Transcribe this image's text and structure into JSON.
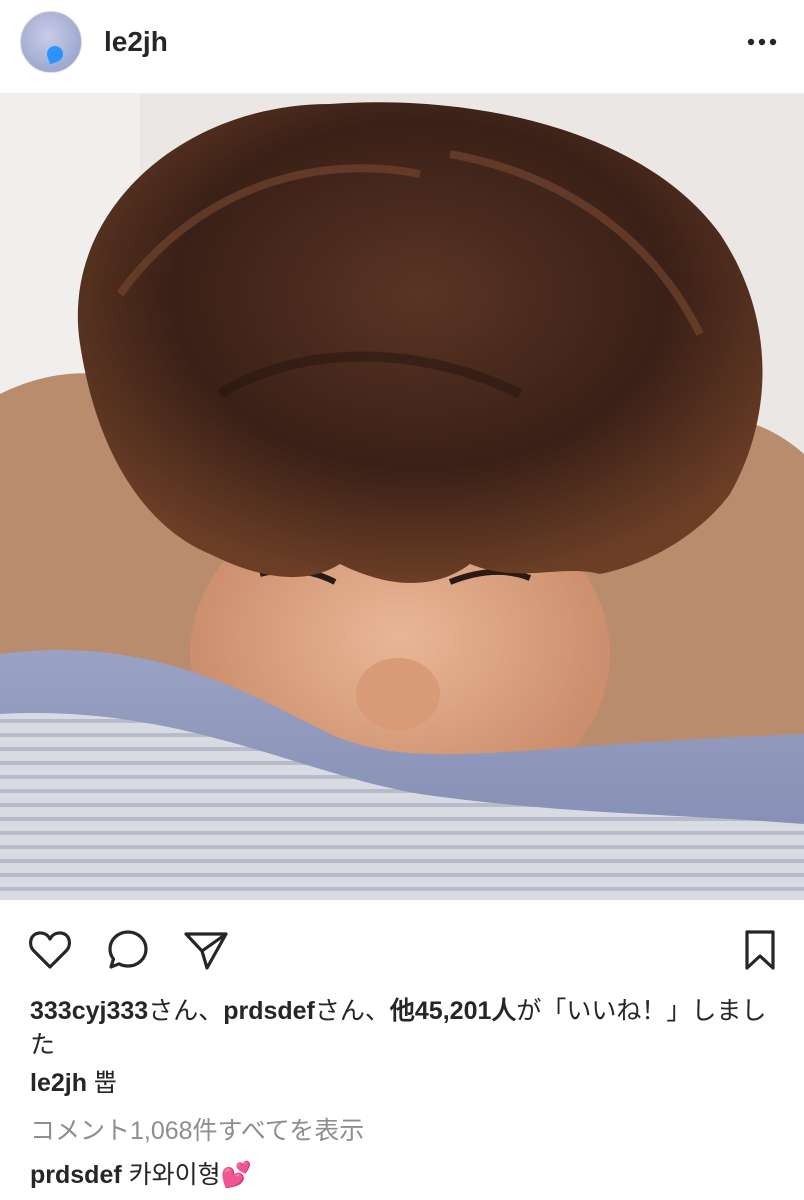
{
  "post": {
    "username": "le2jh",
    "more_icon": "more-horizontal-icon"
  },
  "photo": {
    "description_icon": "photo"
  },
  "actions": {
    "like_icon": "heart-outline-icon",
    "comment_icon": "speech-bubble-icon",
    "share_icon": "paper-plane-icon",
    "save_icon": "bookmark-icon"
  },
  "likes": {
    "user1": "333cyj333",
    "suffix1": "さん、",
    "user2": "prdsdef",
    "suffix2": "さん、",
    "others": "他45,201人",
    "tail": "が「いいね！」しました"
  },
  "caption": {
    "username": "le2jh",
    "text": "뿝"
  },
  "comments": {
    "view_all": "コメント1,068件すべてを表示",
    "first": {
      "username": "prdsdef",
      "text": "카와이형",
      "emoji": "💕"
    }
  },
  "colors": {
    "text": "#262626",
    "muted": "#8e8e8e",
    "emoji_pink": "#ff4fa3"
  }
}
